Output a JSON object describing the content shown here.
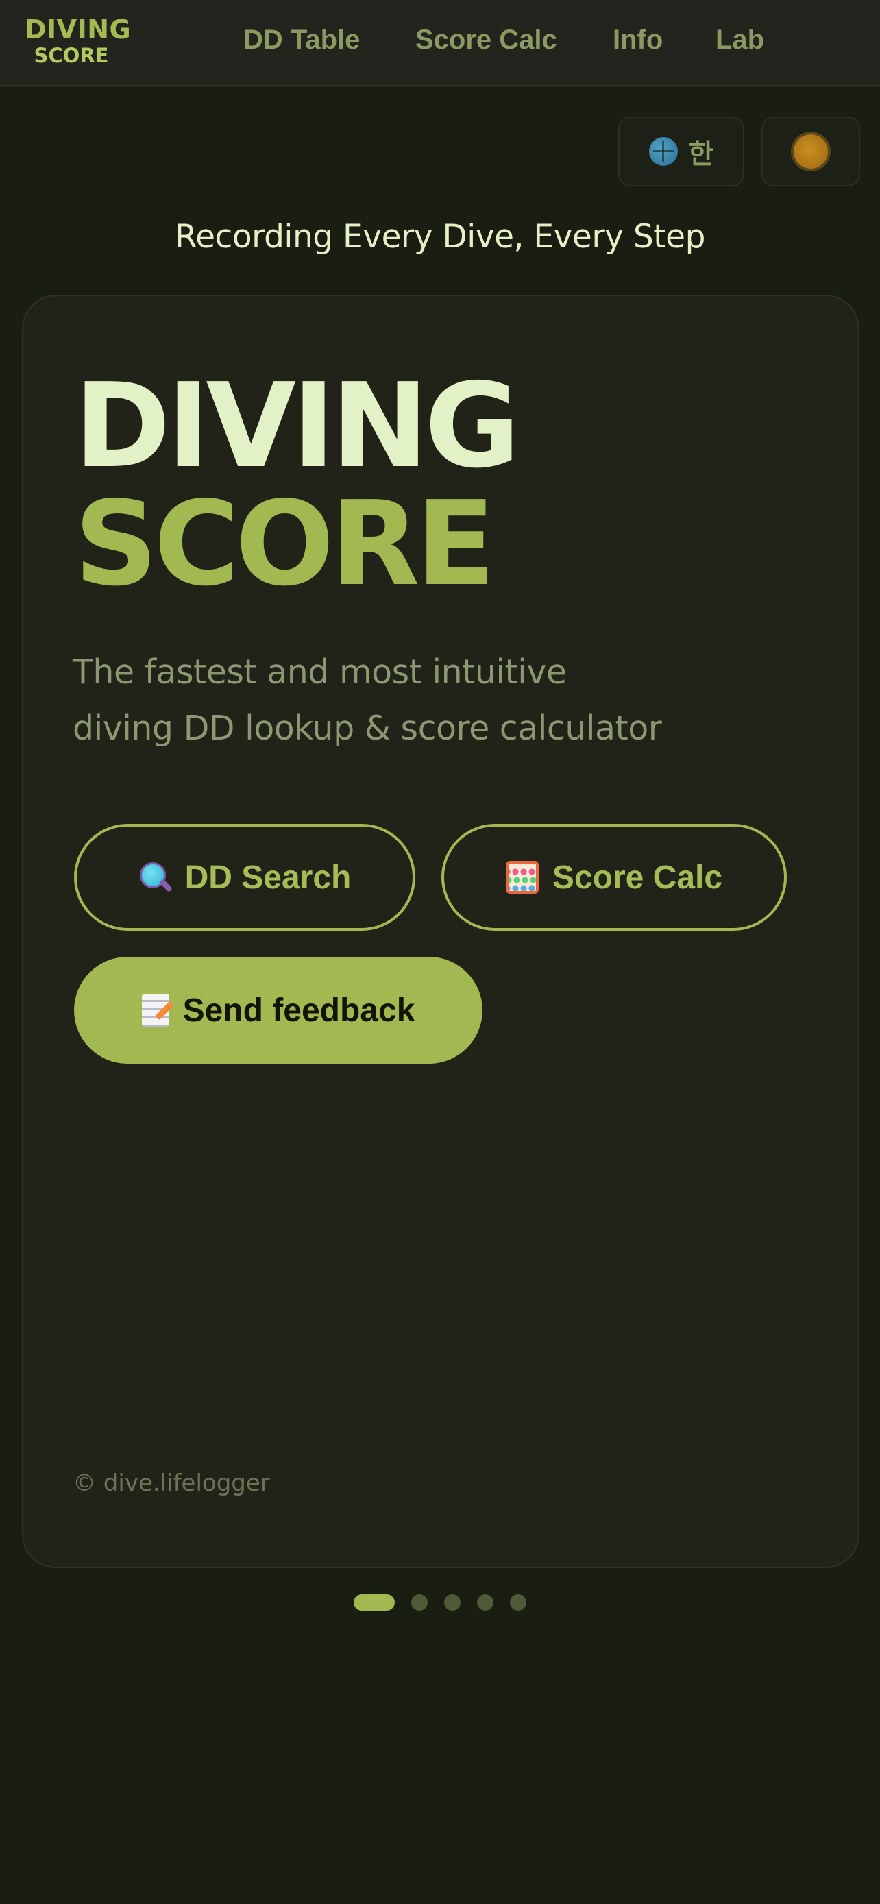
{
  "nav": {
    "logo_line1": "DIVING",
    "logo_line2": "SCORE",
    "links": [
      "DD Table",
      "Score Calc",
      "Info",
      "Lab"
    ]
  },
  "controls": {
    "language_label": "한",
    "language_icon": "globe-icon",
    "theme_icon": "sun-icon"
  },
  "tagline": "Recording Every Dive, Every Step",
  "hero": {
    "title_line1": "DIVING",
    "title_line2": "SCORE",
    "desc_line1": "The fastest and most intuitive",
    "desc_line2": "diving DD lookup & score calculator"
  },
  "buttons": {
    "search_label": "DD Search",
    "search_icon": "magnifier-icon",
    "calc_label": "Score Calc",
    "calc_icon": "abacus-icon",
    "feedback_label": "Send feedback",
    "feedback_icon": "memo-icon"
  },
  "footer": "© dive.lifelogger",
  "pager": {
    "count": 5,
    "active_index": 0
  },
  "colors": {
    "accent": "#a2b851",
    "background": "#1a1d12",
    "card": "#212319",
    "title_light": "#e3f2c6",
    "muted": "#8c9872"
  }
}
